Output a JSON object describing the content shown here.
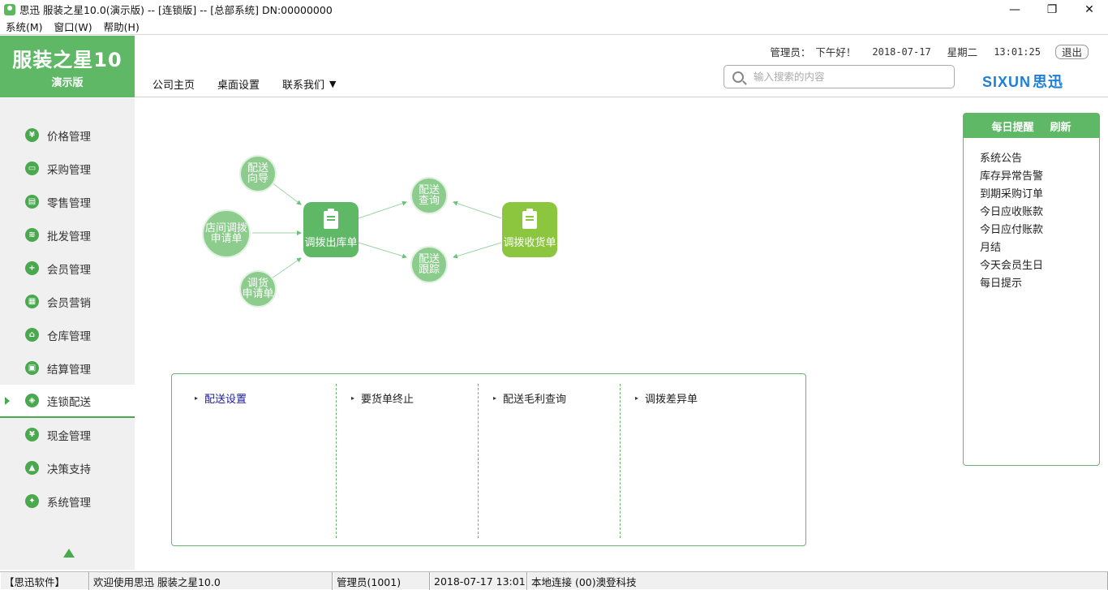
{
  "window": {
    "title": "思迅 服装之星10.0(演示版) -- [连锁版] -- [总部系统] DN:00000000",
    "controls": {
      "minimize": "—",
      "maximize": "❐",
      "close": "✕"
    }
  },
  "menubar": [
    "系统(M)",
    "窗口(W)",
    "帮助(H)"
  ],
  "logo": {
    "product": "服装之星10",
    "edition": "演示版"
  },
  "topnav": {
    "home": "公司主页",
    "desktop": "桌面设置",
    "contact": "联系我们",
    "caret": "▼"
  },
  "userinfo": {
    "role": "管理员：",
    "greeting": "下午好！",
    "date": "2018-07-17",
    "weekday": "星期二",
    "time": "13:01:25",
    "logout": "退出"
  },
  "search": {
    "placeholder": "输入搜索的内容"
  },
  "brand": {
    "latin": "SIXUN",
    "cn": "思迅"
  },
  "sidebar": {
    "items": [
      {
        "label": "价格管理",
        "icon": "yen-icon",
        "glyph": "¥"
      },
      {
        "label": "采购管理",
        "icon": "basket-icon",
        "glyph": "▭"
      },
      {
        "label": "零售管理",
        "icon": "bag-icon",
        "glyph": "▤"
      },
      {
        "label": "批发管理",
        "icon": "wholesale-icon",
        "glyph": "≋"
      },
      {
        "label": "会员管理",
        "icon": "member-icon",
        "glyph": "+"
      },
      {
        "label": "会员营销",
        "icon": "marketing-icon",
        "glyph": "▦"
      },
      {
        "label": "仓库管理",
        "icon": "warehouse-icon",
        "glyph": "⌂"
      },
      {
        "label": "结算管理",
        "icon": "settlement-icon",
        "glyph": "▣"
      },
      {
        "label": "连锁配送",
        "icon": "chain-delivery-icon",
        "glyph": "◈",
        "active": true
      },
      {
        "label": "现金管理",
        "icon": "cash-icon",
        "glyph": "¥"
      },
      {
        "label": "决策支持",
        "icon": "thumbs-up-icon",
        "glyph": "▲"
      },
      {
        "label": "系统管理",
        "icon": "gear-icon",
        "glyph": "✦"
      }
    ]
  },
  "flow": {
    "guide": "配送\n向导",
    "store_transfer_request": "店间调拨\n申请单",
    "transfer_request": "调货\n申请单",
    "transfer_out": "调拨出库单",
    "delivery_query": "配送\n查询",
    "delivery_track": "配送\n跟踪",
    "transfer_in": "调拨收货单"
  },
  "functions": [
    "配送设置",
    "要货单终止",
    "配送毛利查询",
    "调拨差异单"
  ],
  "reminder": {
    "title": "每日提醒",
    "refresh": "刷新",
    "items": [
      "系统公告",
      "库存异常告警",
      "到期采购订单",
      "今日应收账款",
      "今日应付账款",
      "月结",
      "今天会员生日",
      "每日提示"
    ]
  },
  "statusbar": [
    "【思迅软件】",
    "欢迎使用思迅 服装之星10.0",
    "管理员(1001)",
    "2018-07-17 13:01",
    "本地连接 (00)澳登科技"
  ],
  "colors": {
    "accent": "#5fb866",
    "brand_blue": "#1f7fd6",
    "transfer_in": "#8cc63f",
    "transfer_out": "#5fb866",
    "circle": "#8ccc8d"
  }
}
